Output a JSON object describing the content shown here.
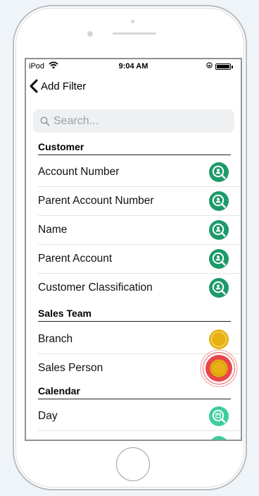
{
  "status_bar": {
    "carrier": "iPod",
    "time": "9:04 AM"
  },
  "nav": {
    "back_label": "Add Filter"
  },
  "search": {
    "placeholder": "Search...",
    "value": ""
  },
  "sections": [
    {
      "title": "Customer",
      "items": [
        {
          "label": "Account Number",
          "icon": "customer-search-icon"
        },
        {
          "label": "Parent Account Number",
          "icon": "customer-search-icon"
        },
        {
          "label": "Name",
          "icon": "customer-search-icon"
        },
        {
          "label": "Parent Account",
          "icon": "customer-search-icon"
        },
        {
          "label": "Customer Classification",
          "icon": "customer-search-icon"
        }
      ]
    },
    {
      "title": "Sales Team",
      "items": [
        {
          "label": "Branch",
          "icon": "sales-team-icon"
        },
        {
          "label": "Sales Person",
          "icon": "sales-team-icon"
        }
      ]
    },
    {
      "title": "Calendar",
      "items": [
        {
          "label": "Day",
          "icon": "calendar-search-icon"
        }
      ]
    }
  ],
  "colors": {
    "customer_icon": "#1e9a6a",
    "sales_team_icon": "#e8b012",
    "calendar_icon": "#3ccf9b",
    "highlight_ring": "#e8474a"
  }
}
